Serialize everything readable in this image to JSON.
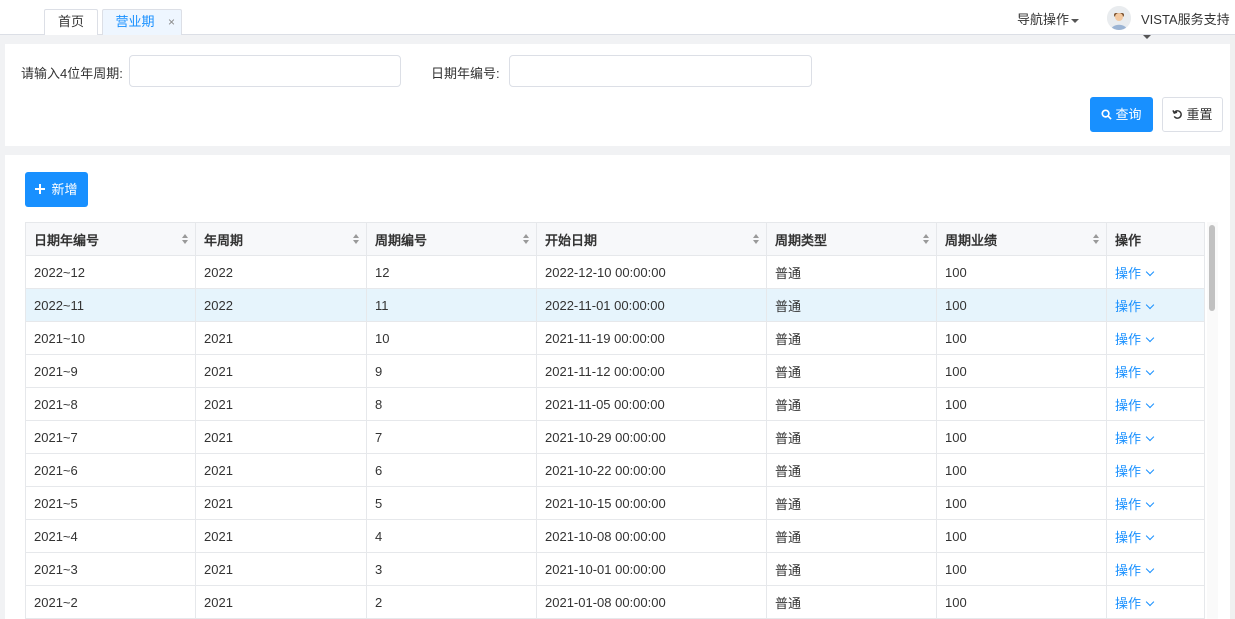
{
  "tabs": {
    "home": "首页",
    "active": "营业期",
    "close_icon": "×"
  },
  "header": {
    "nav_ops": "导航操作",
    "user_name": "VISTA服务支持"
  },
  "search": {
    "year_period_label": "请输入4位年周期:",
    "year_period_value": "",
    "date_year_no_label": "日期年编号:",
    "date_year_no_value": "",
    "query_label": "查询",
    "reset_label": "重置"
  },
  "toolbar": {
    "add_label": "新增"
  },
  "table": {
    "columns": [
      "日期年编号",
      "年周期",
      "周期编号",
      "开始日期",
      "周期类型",
      "周期业绩",
      "操作"
    ],
    "rows": [
      {
        "code": "2022~12",
        "year": "2022",
        "no": "12",
        "start": "2022-12-10 00:00:00",
        "type": "普通",
        "perf": "100",
        "op": "操作"
      },
      {
        "code": "2022~11",
        "year": "2022",
        "no": "11",
        "start": "2022-11-01 00:00:00",
        "type": "普通",
        "perf": "100",
        "op": "操作"
      },
      {
        "code": "2021~10",
        "year": "2021",
        "no": "10",
        "start": "2021-11-19 00:00:00",
        "type": "普通",
        "perf": "100",
        "op": "操作"
      },
      {
        "code": "2021~9",
        "year": "2021",
        "no": "9",
        "start": "2021-11-12 00:00:00",
        "type": "普通",
        "perf": "100",
        "op": "操作"
      },
      {
        "code": "2021~8",
        "year": "2021",
        "no": "8",
        "start": "2021-11-05 00:00:00",
        "type": "普通",
        "perf": "100",
        "op": "操作"
      },
      {
        "code": "2021~7",
        "year": "2021",
        "no": "7",
        "start": "2021-10-29 00:00:00",
        "type": "普通",
        "perf": "100",
        "op": "操作"
      },
      {
        "code": "2021~6",
        "year": "2021",
        "no": "6",
        "start": "2021-10-22 00:00:00",
        "type": "普通",
        "perf": "100",
        "op": "操作"
      },
      {
        "code": "2021~5",
        "year": "2021",
        "no": "5",
        "start": "2021-10-15 00:00:00",
        "type": "普通",
        "perf": "100",
        "op": "操作"
      },
      {
        "code": "2021~4",
        "year": "2021",
        "no": "4",
        "start": "2021-10-08 00:00:00",
        "type": "普通",
        "perf": "100",
        "op": "操作"
      },
      {
        "code": "2021~3",
        "year": "2021",
        "no": "3",
        "start": "2021-10-01 00:00:00",
        "type": "普通",
        "perf": "100",
        "op": "操作"
      },
      {
        "code": "2021~2",
        "year": "2021",
        "no": "2",
        "start": "2021-01-08 00:00:00",
        "type": "普通",
        "perf": "100",
        "op": "操作"
      }
    ],
    "highlighted_row": 1
  },
  "colors": {
    "primary": "#1890ff",
    "row_highlight": "#e6f4fc"
  }
}
